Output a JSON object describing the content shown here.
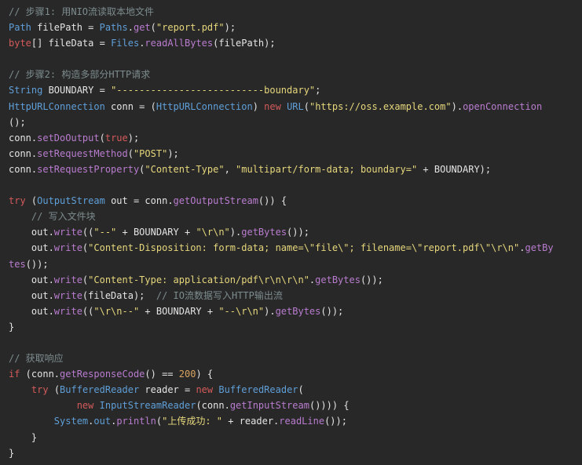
{
  "code": {
    "language": "java",
    "lines": [
      [
        {
          "t": "// 步骤1: 用NIO流读取本地文件",
          "c": "comment"
        }
      ],
      [
        {
          "t": "Path",
          "c": "type"
        },
        {
          "t": " filePath = ",
          "c": "ident"
        },
        {
          "t": "Paths",
          "c": "type"
        },
        {
          "t": ".",
          "c": "ident"
        },
        {
          "t": "get",
          "c": "method"
        },
        {
          "t": "(",
          "c": "ident"
        },
        {
          "t": "\"report.pdf\"",
          "c": "str"
        },
        {
          "t": ");",
          "c": "ident"
        }
      ],
      [
        {
          "t": "byte",
          "c": "kw"
        },
        {
          "t": "[] fileData = ",
          "c": "ident"
        },
        {
          "t": "Files",
          "c": "type"
        },
        {
          "t": ".",
          "c": "ident"
        },
        {
          "t": "readAllBytes",
          "c": "method"
        },
        {
          "t": "(filePath);",
          "c": "ident"
        }
      ],
      [],
      [
        {
          "t": "// 步骤2: 构造多部分HTTP请求",
          "c": "comment"
        }
      ],
      [
        {
          "t": "String",
          "c": "type"
        },
        {
          "t": " BOUNDARY = ",
          "c": "ident"
        },
        {
          "t": "\"--------------------------boundary\"",
          "c": "str"
        },
        {
          "t": ";",
          "c": "ident"
        }
      ],
      [
        {
          "t": "HttpURLConnection",
          "c": "type"
        },
        {
          "t": " conn = (",
          "c": "ident"
        },
        {
          "t": "HttpURLConnection",
          "c": "type"
        },
        {
          "t": ") ",
          "c": "ident"
        },
        {
          "t": "new",
          "c": "kw"
        },
        {
          "t": " ",
          "c": "ident"
        },
        {
          "t": "URL",
          "c": "type"
        },
        {
          "t": "(",
          "c": "ident"
        },
        {
          "t": "\"https://oss.example.com\"",
          "c": "str"
        },
        {
          "t": ").",
          "c": "ident"
        },
        {
          "t": "openConnection",
          "c": "method"
        }
      ],
      [
        {
          "t": "();",
          "c": "ident"
        }
      ],
      [
        {
          "t": "conn.",
          "c": "ident"
        },
        {
          "t": "setDoOutput",
          "c": "method"
        },
        {
          "t": "(",
          "c": "ident"
        },
        {
          "t": "true",
          "c": "kw"
        },
        {
          "t": ");",
          "c": "ident"
        }
      ],
      [
        {
          "t": "conn.",
          "c": "ident"
        },
        {
          "t": "setRequestMethod",
          "c": "method"
        },
        {
          "t": "(",
          "c": "ident"
        },
        {
          "t": "\"POST\"",
          "c": "str"
        },
        {
          "t": ");",
          "c": "ident"
        }
      ],
      [
        {
          "t": "conn.",
          "c": "ident"
        },
        {
          "t": "setRequestProperty",
          "c": "method"
        },
        {
          "t": "(",
          "c": "ident"
        },
        {
          "t": "\"Content-Type\"",
          "c": "str"
        },
        {
          "t": ", ",
          "c": "ident"
        },
        {
          "t": "\"multipart/form-data; boundary=\"",
          "c": "str"
        },
        {
          "t": " + BOUNDARY);",
          "c": "ident"
        }
      ],
      [],
      [
        {
          "t": "try",
          "c": "kw"
        },
        {
          "t": " (",
          "c": "ident"
        },
        {
          "t": "OutputStream",
          "c": "type"
        },
        {
          "t": " out = conn.",
          "c": "ident"
        },
        {
          "t": "getOutputStream",
          "c": "method"
        },
        {
          "t": "()) {",
          "c": "ident"
        }
      ],
      [
        {
          "t": "    ",
          "c": "ident"
        },
        {
          "t": "// 写入文件块",
          "c": "comment"
        }
      ],
      [
        {
          "t": "    out.",
          "c": "ident"
        },
        {
          "t": "write",
          "c": "method"
        },
        {
          "t": "((",
          "c": "ident"
        },
        {
          "t": "\"--\"",
          "c": "str"
        },
        {
          "t": " + BOUNDARY + ",
          "c": "ident"
        },
        {
          "t": "\"\\r\\n\"",
          "c": "str"
        },
        {
          "t": ").",
          "c": "ident"
        },
        {
          "t": "getBytes",
          "c": "method"
        },
        {
          "t": "());",
          "c": "ident"
        }
      ],
      [
        {
          "t": "    out.",
          "c": "ident"
        },
        {
          "t": "write",
          "c": "method"
        },
        {
          "t": "(",
          "c": "ident"
        },
        {
          "t": "\"Content-Disposition: form-data; name=\\\"file\\\"; filename=\\\"report.pdf\\\"\\r\\n\"",
          "c": "str"
        },
        {
          "t": ".",
          "c": "ident"
        },
        {
          "t": "getBy",
          "c": "method"
        }
      ],
      [
        {
          "t": "tes",
          "c": "method"
        },
        {
          "t": "());",
          "c": "ident"
        }
      ],
      [
        {
          "t": "    out.",
          "c": "ident"
        },
        {
          "t": "write",
          "c": "method"
        },
        {
          "t": "(",
          "c": "ident"
        },
        {
          "t": "\"Content-Type: application/pdf\\r\\n\\r\\n\"",
          "c": "str"
        },
        {
          "t": ".",
          "c": "ident"
        },
        {
          "t": "getBytes",
          "c": "method"
        },
        {
          "t": "());",
          "c": "ident"
        }
      ],
      [
        {
          "t": "    out.",
          "c": "ident"
        },
        {
          "t": "write",
          "c": "method"
        },
        {
          "t": "(fileData);  ",
          "c": "ident"
        },
        {
          "t": "// IO流数据写入HTTP输出流",
          "c": "comment"
        }
      ],
      [
        {
          "t": "    out.",
          "c": "ident"
        },
        {
          "t": "write",
          "c": "method"
        },
        {
          "t": "((",
          "c": "ident"
        },
        {
          "t": "\"\\r\\n--\"",
          "c": "str"
        },
        {
          "t": " + BOUNDARY + ",
          "c": "ident"
        },
        {
          "t": "\"--\\r\\n\"",
          "c": "str"
        },
        {
          "t": ").",
          "c": "ident"
        },
        {
          "t": "getBytes",
          "c": "method"
        },
        {
          "t": "());",
          "c": "ident"
        }
      ],
      [
        {
          "t": "}",
          "c": "ident"
        }
      ],
      [],
      [
        {
          "t": "// 获取响应",
          "c": "comment"
        }
      ],
      [
        {
          "t": "if",
          "c": "kw"
        },
        {
          "t": " (conn.",
          "c": "ident"
        },
        {
          "t": "getResponseCode",
          "c": "method"
        },
        {
          "t": "() == ",
          "c": "ident"
        },
        {
          "t": "200",
          "c": "num"
        },
        {
          "t": ") {",
          "c": "ident"
        }
      ],
      [
        {
          "t": "    ",
          "c": "ident"
        },
        {
          "t": "try",
          "c": "kw"
        },
        {
          "t": " (",
          "c": "ident"
        },
        {
          "t": "BufferedReader",
          "c": "type"
        },
        {
          "t": " reader = ",
          "c": "ident"
        },
        {
          "t": "new",
          "c": "kw"
        },
        {
          "t": " ",
          "c": "ident"
        },
        {
          "t": "BufferedReader",
          "c": "type"
        },
        {
          "t": "(",
          "c": "ident"
        }
      ],
      [
        {
          "t": "            ",
          "c": "ident"
        },
        {
          "t": "new",
          "c": "kw"
        },
        {
          "t": " ",
          "c": "ident"
        },
        {
          "t": "InputStreamReader",
          "c": "type"
        },
        {
          "t": "(conn.",
          "c": "ident"
        },
        {
          "t": "getInputStream",
          "c": "method"
        },
        {
          "t": "()))) {",
          "c": "ident"
        }
      ],
      [
        {
          "t": "        ",
          "c": "ident"
        },
        {
          "t": "System",
          "c": "type"
        },
        {
          "t": ".",
          "c": "ident"
        },
        {
          "t": "out",
          "c": "type"
        },
        {
          "t": ".",
          "c": "ident"
        },
        {
          "t": "println",
          "c": "method"
        },
        {
          "t": "(",
          "c": "ident"
        },
        {
          "t": "\"上传成功: \"",
          "c": "str"
        },
        {
          "t": " + reader.",
          "c": "ident"
        },
        {
          "t": "readLine",
          "c": "method"
        },
        {
          "t": "());",
          "c": "ident"
        }
      ],
      [
        {
          "t": "    }",
          "c": "ident"
        }
      ],
      [
        {
          "t": "}",
          "c": "ident"
        }
      ]
    ]
  },
  "colors": {
    "background": "#282828",
    "comment": "#7d8c8e",
    "keyword": "#d45a5a",
    "type": "#5f9fd8",
    "method": "#b97ccf",
    "string": "#e6d77c",
    "number": "#d9a460",
    "identifier": "#e4e4e4"
  }
}
